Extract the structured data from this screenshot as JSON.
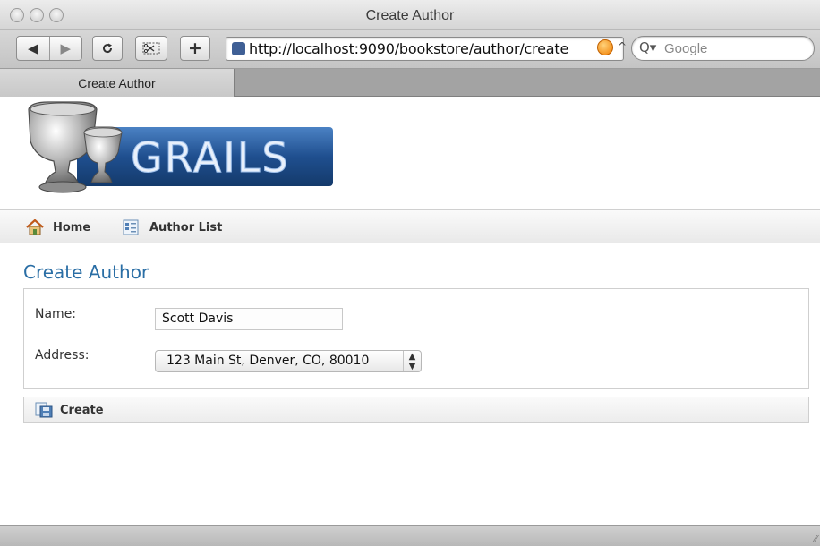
{
  "window": {
    "title": "Create Author"
  },
  "toolbar": {
    "back_icon": "back-arrow-icon",
    "forward_icon": "forward-arrow-icon",
    "reload_icon": "reload-icon",
    "snippet_icon": "clip-icon",
    "add_label": "+",
    "url": "http://localhost:9090/bookstore/author/create",
    "search_placeholder": "Google"
  },
  "tabs": [
    {
      "label": "Create Author"
    }
  ],
  "nav": {
    "home_label": "Home",
    "list_label": "Author List"
  },
  "page": {
    "heading": "Create Author",
    "name_label": "Name:",
    "name_value": "Scott Davis",
    "address_label": "Address:",
    "address_value": "123 Main St, Denver, CO, 80010",
    "create_label": "Create"
  },
  "colors": {
    "heading": "#2a6ea5",
    "rss": "#f07d00",
    "logo_bg": "#1f4f8f"
  }
}
